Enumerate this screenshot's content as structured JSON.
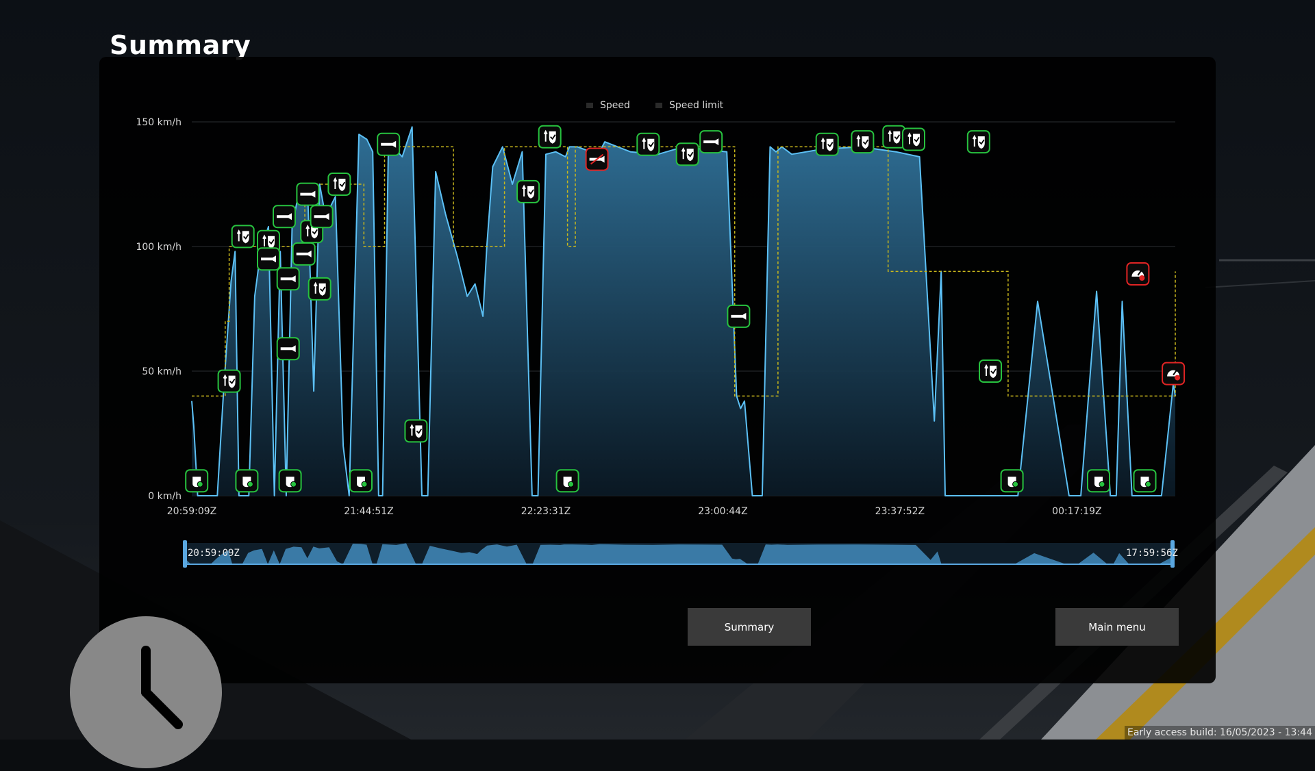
{
  "page": {
    "title": "Summary",
    "build_info": "Early access build: 16/05/2023 - 13:44"
  },
  "legend": {
    "speed": "Speed",
    "speed_limit": "Speed limit"
  },
  "navigator": {
    "start_label": "20:59:09Z",
    "end_label": "17:59:56Z"
  },
  "buttons": {
    "summary": "Summary",
    "main_menu": "Main menu"
  },
  "colors": {
    "speed_line": "#5cc0f5",
    "speed_fill": "#2f6f96",
    "limit_line": "#c9b81c",
    "marker_ok": "#27c23f",
    "marker_bad": "#e02424"
  },
  "chart_data": {
    "type": "area",
    "y_unit": "km/h",
    "ylim": [
      0,
      150
    ],
    "y_ticks": [
      "0 km/h",
      "50 km/h",
      "100 km/h",
      "150 km/h"
    ],
    "y_tick_values": [
      0,
      50,
      100,
      150
    ],
    "x_tick_labels": [
      "20:59:09Z",
      "21:44:51Z",
      "22:23:31Z",
      "23:00:44Z",
      "23:37:52Z",
      "00:17:19Z"
    ],
    "x_tick_positions": [
      0,
      0.18,
      0.36,
      0.54,
      0.72,
      0.9
    ],
    "grid": true,
    "legend": "top",
    "series": [
      {
        "name": "Speed",
        "x": [
          0.0,
          0.002,
          0.006,
          0.026,
          0.032,
          0.04,
          0.044,
          0.048,
          0.058,
          0.064,
          0.07,
          0.078,
          0.084,
          0.09,
          0.096,
          0.102,
          0.11,
          0.118,
          0.124,
          0.13,
          0.136,
          0.146,
          0.154,
          0.16,
          0.17,
          0.178,
          0.184,
          0.19,
          0.194,
          0.2,
          0.214,
          0.224,
          0.234,
          0.24,
          0.248,
          0.258,
          0.27,
          0.28,
          0.288,
          0.296,
          0.3,
          0.306,
          0.316,
          0.326,
          0.336,
          0.346,
          0.352,
          0.36,
          0.37,
          0.38,
          0.384,
          0.392,
          0.406,
          0.412,
          0.42,
          0.446,
          0.474,
          0.5,
          0.52,
          0.544,
          0.554,
          0.558,
          0.562,
          0.57,
          0.58,
          0.588,
          0.594,
          0.6,
          0.61,
          0.64,
          0.68,
          0.716,
          0.74,
          0.755,
          0.762,
          0.766,
          0.78,
          0.8,
          0.816,
          0.826,
          0.84,
          0.86,
          0.892,
          0.904,
          0.92,
          0.934,
          0.94,
          0.946,
          0.956,
          0.962,
          0.97,
          0.976,
          0.986,
          0.998,
          1.0
        ],
        "values": [
          38,
          28,
          0,
          0,
          40,
          86,
          98,
          0,
          0,
          80,
          98,
          108,
          0,
          98,
          0,
          108,
          124,
          120,
          42,
          125,
          112,
          120,
          20,
          0,
          145,
          143,
          138,
          0,
          0,
          142,
          136,
          148,
          0,
          0,
          130,
          113,
          96,
          80,
          85,
          72,
          100,
          132,
          140,
          125,
          138,
          0,
          0,
          137,
          138,
          136,
          140,
          140,
          138,
          136,
          142,
          138,
          137,
          140,
          139,
          138,
          40,
          35,
          38,
          0,
          0,
          140,
          138,
          140,
          137,
          139,
          140,
          138,
          136,
          30,
          90,
          0,
          0,
          0,
          0,
          0,
          0,
          78,
          0,
          0,
          82,
          0,
          0,
          78,
          0,
          0,
          0,
          0,
          0,
          45,
          40
        ]
      }
    ],
    "speed_limit": {
      "x": [
        0.0,
        0.03,
        0.034,
        0.038,
        0.06,
        0.115,
        0.165,
        0.175,
        0.186,
        0.196,
        0.206,
        0.236,
        0.266,
        0.304,
        0.318,
        0.346,
        0.382,
        0.39,
        0.542,
        0.552,
        0.588,
        0.596,
        0.702,
        0.708,
        0.77,
        0.79,
        0.83,
        0.84,
        0.91,
        1.0
      ],
      "values": [
        40,
        40,
        70,
        100,
        100,
        125,
        125,
        100,
        100,
        140,
        140,
        140,
        100,
        100,
        140,
        140,
        100,
        140,
        140,
        40,
        40,
        140,
        140,
        90,
        90,
        90,
        40,
        40,
        40,
        90
      ]
    }
  },
  "markers": [
    {
      "icon": "stop-ok",
      "x": 0.005,
      "y": 6,
      "status": "ok"
    },
    {
      "icon": "stop-ok",
      "x": 0.056,
      "y": 6,
      "status": "ok"
    },
    {
      "icon": "stop-ok",
      "x": 0.1,
      "y": 6,
      "status": "ok"
    },
    {
      "icon": "stop-ok",
      "x": 0.172,
      "y": 6,
      "status": "ok"
    },
    {
      "icon": "stop-ok",
      "x": 0.382,
      "y": 6,
      "status": "ok"
    },
    {
      "icon": "stop-ok",
      "x": 0.834,
      "y": 6,
      "status": "ok"
    },
    {
      "icon": "stop-ok",
      "x": 0.922,
      "y": 6,
      "status": "ok"
    },
    {
      "icon": "stop-ok",
      "x": 0.969,
      "y": 6,
      "status": "ok"
    },
    {
      "icon": "speed-check",
      "x": 0.038,
      "y": 46,
      "status": "ok"
    },
    {
      "icon": "speed-check",
      "x": 0.052,
      "y": 104,
      "status": "ok"
    },
    {
      "icon": "speed-check",
      "x": 0.078,
      "y": 102,
      "status": "ok"
    },
    {
      "icon": "speed-check",
      "x": 0.122,
      "y": 106,
      "status": "ok"
    },
    {
      "icon": "speed-check",
      "x": 0.13,
      "y": 83,
      "status": "ok"
    },
    {
      "icon": "speed-check",
      "x": 0.15,
      "y": 125,
      "status": "ok"
    },
    {
      "icon": "speed-check",
      "x": 0.228,
      "y": 26,
      "status": "ok"
    },
    {
      "icon": "speed-check",
      "x": 0.342,
      "y": 122,
      "status": "ok"
    },
    {
      "icon": "speed-check",
      "x": 0.364,
      "y": 144,
      "status": "ok"
    },
    {
      "icon": "speed-check",
      "x": 0.464,
      "y": 141,
      "status": "ok"
    },
    {
      "icon": "speed-check",
      "x": 0.504,
      "y": 137,
      "status": "ok"
    },
    {
      "icon": "speed-check",
      "x": 0.646,
      "y": 141,
      "status": "ok"
    },
    {
      "icon": "speed-check",
      "x": 0.682,
      "y": 142,
      "status": "ok"
    },
    {
      "icon": "speed-check",
      "x": 0.714,
      "y": 144,
      "status": "ok"
    },
    {
      "icon": "speed-check",
      "x": 0.734,
      "y": 143,
      "status": "ok"
    },
    {
      "icon": "speed-check",
      "x": 0.8,
      "y": 142,
      "status": "ok"
    },
    {
      "icon": "speed-check",
      "x": 0.812,
      "y": 50,
      "status": "ok"
    },
    {
      "icon": "horn",
      "x": 0.098,
      "y": 59,
      "status": "ok"
    },
    {
      "icon": "horn",
      "x": 0.078,
      "y": 95,
      "status": "ok"
    },
    {
      "icon": "horn",
      "x": 0.098,
      "y": 87,
      "status": "ok"
    },
    {
      "icon": "horn",
      "x": 0.114,
      "y": 97,
      "status": "ok"
    },
    {
      "icon": "horn",
      "x": 0.094,
      "y": 112,
      "status": "ok"
    },
    {
      "icon": "horn",
      "x": 0.118,
      "y": 121,
      "status": "ok"
    },
    {
      "icon": "horn",
      "x": 0.132,
      "y": 112,
      "status": "ok"
    },
    {
      "icon": "horn",
      "x": 0.2,
      "y": 141,
      "status": "ok"
    },
    {
      "icon": "horn",
      "x": 0.528,
      "y": 142,
      "status": "ok"
    },
    {
      "icon": "horn",
      "x": 0.556,
      "y": 72,
      "status": "ok"
    },
    {
      "icon": "horn-missed",
      "x": 0.412,
      "y": 135,
      "status": "bad"
    },
    {
      "icon": "speedometer-alert",
      "x": 0.962,
      "y": 89,
      "status": "bad"
    },
    {
      "icon": "speedometer-alert",
      "x": 0.998,
      "y": 49,
      "status": "bad"
    }
  ]
}
